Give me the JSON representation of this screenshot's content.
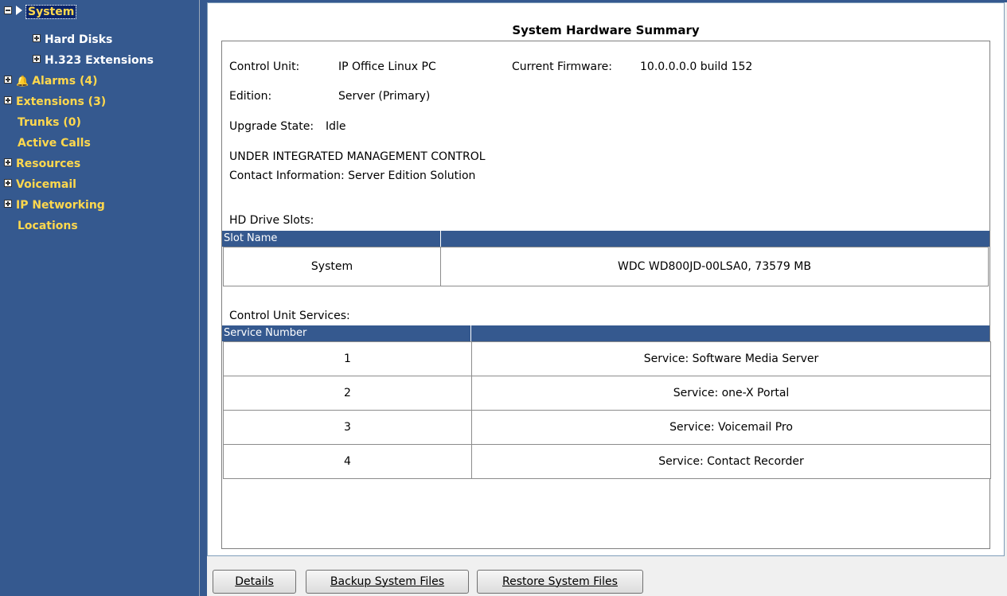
{
  "tree": {
    "system_label": "System",
    "hard_disks": "Hard Disks",
    "h323": "H.323 Extensions",
    "alarms": "Alarms (4)",
    "extensions": "Extensions (3)",
    "trunks": "Trunks (0)",
    "active_calls": "Active Calls",
    "resources": "Resources",
    "voicemail": "Voicemail",
    "ip_networking": "IP Networking",
    "locations": "Locations"
  },
  "summary": {
    "title": "System Hardware Summary",
    "control_unit_label": "Control Unit:",
    "control_unit_value": "IP Office Linux PC",
    "firmware_label": "Current Firmware:",
    "firmware_value": "10.0.0.0.0 build 152",
    "edition_label": "Edition:",
    "edition_value": "Server (Primary)",
    "upgrade_label": "Upgrade State:",
    "upgrade_value": "Idle",
    "mgmt_line": "UNDER INTEGRATED MANAGEMENT CONTROL",
    "contact_line": "Contact Information: Server Edition Solution"
  },
  "hd_slots": {
    "label": "HD Drive Slots:",
    "col1": "Slot Name",
    "rows": [
      {
        "name": "System",
        "value": "WDC WD800JD-00LSA0, 73579 MB"
      }
    ]
  },
  "services": {
    "label": "Control Unit Services:",
    "col1": "Service Number",
    "rows": [
      {
        "num": "1",
        "value": "Service: Software Media Server"
      },
      {
        "num": "2",
        "value": "Service: one-X Portal"
      },
      {
        "num": "3",
        "value": "Service: Voicemail Pro"
      },
      {
        "num": "4",
        "value": "Service: Contact Recorder"
      }
    ]
  },
  "buttons": {
    "details": "Details",
    "backup": "Backup System Files",
    "restore": "Restore System Files"
  }
}
